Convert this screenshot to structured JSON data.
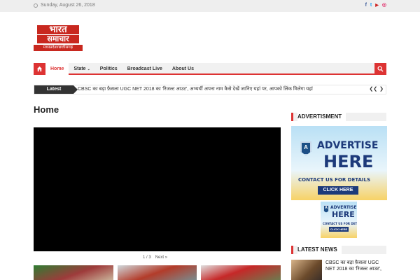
{
  "topbar": {
    "date": "Sunday, August 26, 2018",
    "socials": [
      {
        "icon": "facebook-icon",
        "glyph": "f",
        "color": "#3b5998"
      },
      {
        "icon": "twitter-icon",
        "glyph": "t",
        "color": "#1da1f2"
      },
      {
        "icon": "youtube-icon",
        "glyph": "▶",
        "color": "#cd201f"
      },
      {
        "icon": "instagram-icon",
        "glyph": "◎",
        "color": "#e1306c"
      }
    ]
  },
  "logo": {
    "line1": "भारत",
    "line2": "समाचार",
    "line3": "मध्यप्रदेश/छत्तीसगढ़"
  },
  "nav": {
    "items": [
      {
        "label": "Home",
        "active": true,
        "caret": ""
      },
      {
        "label": "State",
        "active": false,
        "caret": "⌄"
      },
      {
        "label": "Politics",
        "active": false,
        "caret": ""
      },
      {
        "label": "Broadcast Live",
        "active": false,
        "caret": ""
      },
      {
        "label": "About Us",
        "active": false,
        "caret": ""
      }
    ]
  },
  "ticker": {
    "label": "Latest",
    "text": "CBSC का बड़ा फ़ैसला UGC NET 2018 का 'रिजल्ट आउट', अभ्यर्थी अपना नाम कैसे देखें जानिए यहां पर, आपको लिंक मिलेगा यहां",
    "prev": "❮❮",
    "next": "❯"
  },
  "page": {
    "title": "Home"
  },
  "slider": {
    "pager": "1 / 3",
    "next": "Next »"
  },
  "sidebar": {
    "advert_title": "ADVERTISMENT",
    "ad": {
      "badge": "A",
      "line1": "ADVERTISE",
      "line2": "HERE",
      "line3": "CONTACT US FOR DETAILS",
      "button": "CLICK HERE"
    },
    "latest_title": "LATEST NEWS",
    "latest_item": "CBSC का बड़ा फ़ैसला UGC NET 2018 का 'रिजल्ट आउट',"
  },
  "colors": {
    "accent": "#dd3333",
    "dark": "#333333",
    "ad_blue": "#1d3a7a"
  }
}
